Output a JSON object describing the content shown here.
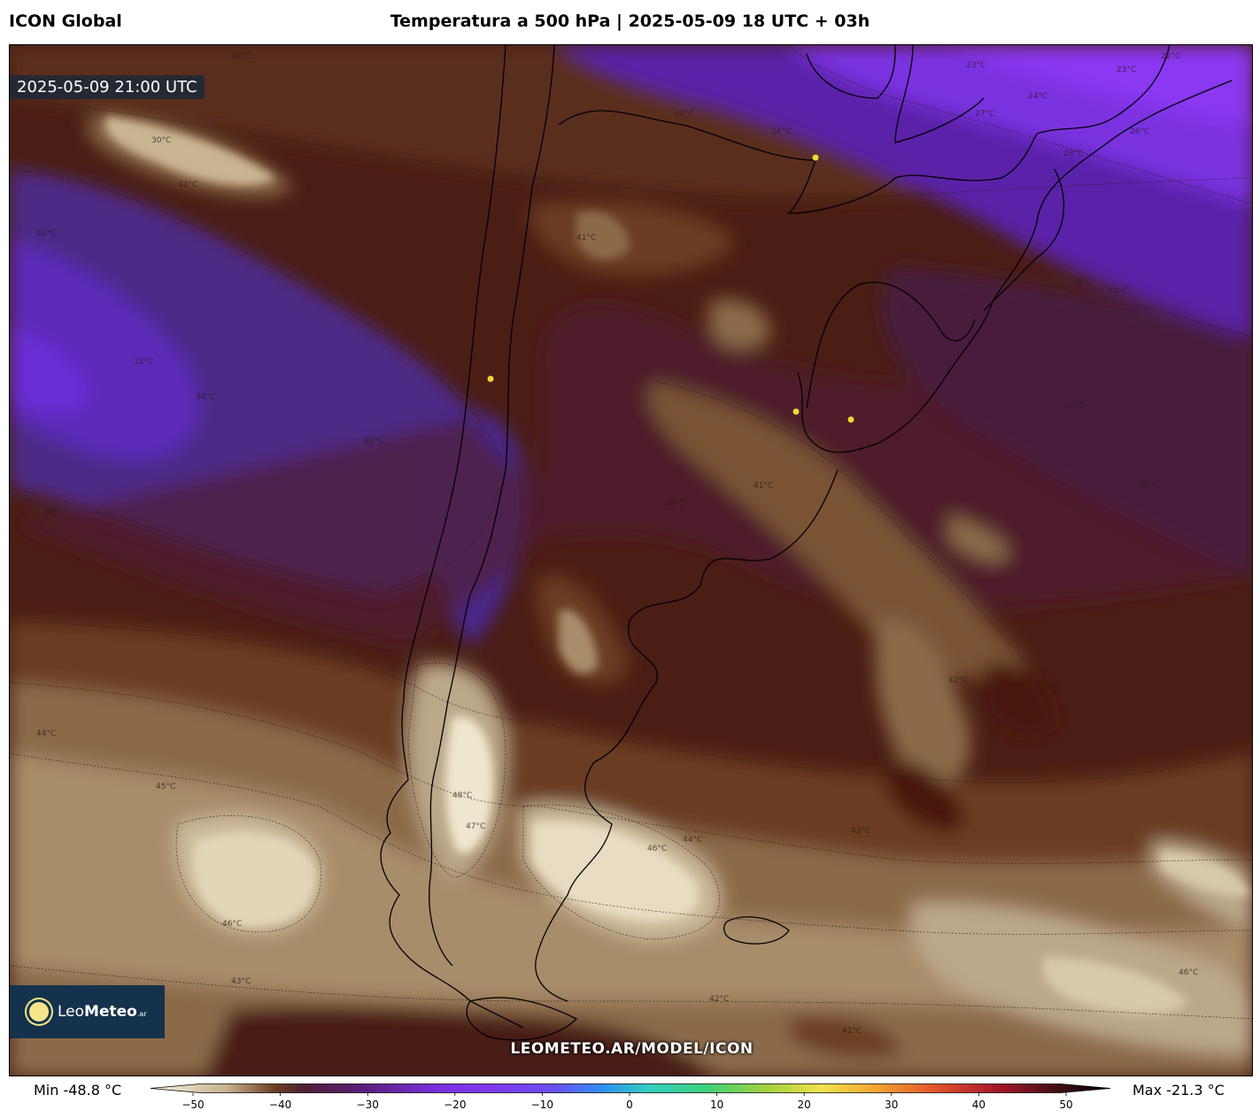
{
  "header": {
    "model": "ICON Global",
    "title": "Temperatura a 500 hPa | 2025-05-09 18 UTC + 03h"
  },
  "map": {
    "timestamp": "2025-05-09 21:00 UTC",
    "logo": {
      "brand_light": "Leo",
      "brand_bold": "Meteo",
      "suffix": ".ar"
    },
    "url": "LEOMETEO.AR/MODEL/ICON",
    "contour_labels": [
      "32°C",
      "30°C",
      "34°C",
      "35°C",
      "36°C",
      "38°C",
      "41°C",
      "42°C",
      "44°C",
      "45°C",
      "46°C",
      "47°C",
      "48°C",
      "43°C",
      "23°C",
      "24°C",
      "22°C",
      "26°C",
      "27°C",
      "28°C",
      "31°C",
      "33°C",
      "39°C",
      "40°C"
    ]
  },
  "legend": {
    "min_label": "Min -48.8 °C",
    "max_label": "Max -21.3 °C",
    "ticks": [
      "−50",
      "−40",
      "−30",
      "−20",
      "−10",
      "0",
      "10",
      "20",
      "30",
      "40",
      "50"
    ],
    "range": [
      -50,
      50
    ]
  },
  "colors": {
    "cold_light": "#efe6cf",
    "tan": "#b29b7a",
    "brown": "#6b3d20",
    "dark_brown": "#47180f",
    "maroon": "#4e1f35",
    "violet": "#5a24a8",
    "purple_bright": "#8a35f0"
  }
}
